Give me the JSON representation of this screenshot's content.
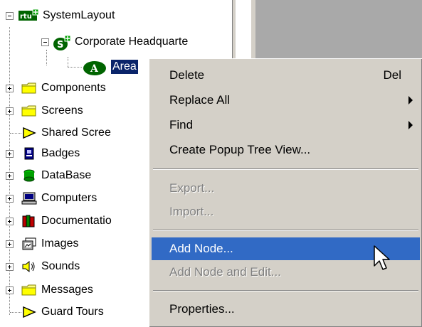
{
  "tree": {
    "root": {
      "label": "SystemLayout",
      "icon": "rtu-icon"
    },
    "child": {
      "label": "Corporate Headquarte",
      "icon": "site-s-icon"
    },
    "grandchild": {
      "label": "Area",
      "icon": "area-a-icon"
    },
    "items": [
      {
        "label": "Components",
        "icon": "folder-icon"
      },
      {
        "label": "Screens",
        "icon": "folder-icon"
      },
      {
        "label": "Shared Scree",
        "icon": "play-arrow-icon"
      },
      {
        "label": "Badges",
        "icon": "badge-icon"
      },
      {
        "label": "DataBase",
        "icon": "database-icon"
      },
      {
        "label": "Computers",
        "icon": "computer-icon"
      },
      {
        "label": "Documentatio",
        "icon": "books-icon"
      },
      {
        "label": "Images",
        "icon": "images-icon"
      },
      {
        "label": "Sounds",
        "icon": "speaker-icon"
      },
      {
        "label": "Messages",
        "icon": "folder-icon"
      },
      {
        "label": "Guard Tours",
        "icon": "play-arrow-icon"
      }
    ]
  },
  "context_menu": {
    "items": [
      {
        "label": "Delete",
        "shortcut": "Del"
      },
      {
        "label": "Replace All"
      },
      {
        "label": "Find"
      },
      {
        "label": "Create Popup Tree View..."
      },
      {
        "label": "Export..."
      },
      {
        "label": "Import..."
      },
      {
        "label": "Add Node..."
      },
      {
        "label": "Add Node and Edit..."
      },
      {
        "label": "Properties..."
      }
    ]
  },
  "colors": {
    "menu_bg": "#d4d0c8",
    "highlight": "#316ac5",
    "tree_selection": "#0a246a",
    "disabled_text": "#808080",
    "side_panel": "#a9a9a9"
  }
}
